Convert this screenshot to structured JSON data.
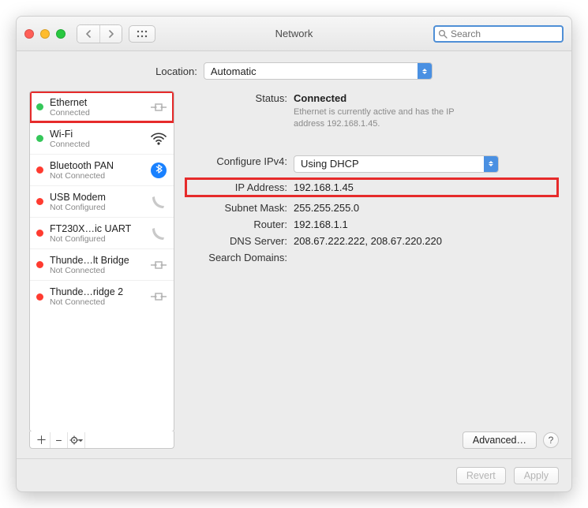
{
  "window": {
    "title": "Network"
  },
  "search": {
    "placeholder": "Search"
  },
  "location": {
    "label": "Location:",
    "value": "Automatic"
  },
  "sidebar": {
    "items": [
      {
        "name": "Ethernet",
        "status": "Connected",
        "dot": "green",
        "icon": "ethernet"
      },
      {
        "name": "Wi-Fi",
        "status": "Connected",
        "dot": "green",
        "icon": "wifi"
      },
      {
        "name": "Bluetooth PAN",
        "status": "Not Connected",
        "dot": "red",
        "icon": "bluetooth"
      },
      {
        "name": "USB Modem",
        "status": "Not Configured",
        "dot": "red",
        "icon": "phone"
      },
      {
        "name": "FT230X…ic UART",
        "status": "Not Configured",
        "dot": "red",
        "icon": "phone"
      },
      {
        "name": "Thunde…lt Bridge",
        "status": "Not Connected",
        "dot": "red",
        "icon": "ethernet"
      },
      {
        "name": "Thunde…ridge 2",
        "status": "Not Connected",
        "dot": "red",
        "icon": "ethernet"
      }
    ]
  },
  "detail": {
    "status_label": "Status:",
    "status_value": "Connected",
    "status_desc": "Ethernet is currently active and has the IP address 192.168.1.45.",
    "configure_label": "Configure IPv4:",
    "configure_value": "Using DHCP",
    "ip_label": "IP Address:",
    "ip_value": "192.168.1.45",
    "subnet_label": "Subnet Mask:",
    "subnet_value": "255.255.255.0",
    "router_label": "Router:",
    "router_value": "192.168.1.1",
    "dns_label": "DNS Server:",
    "dns_value": "208.67.222.222, 208.67.220.220",
    "search_domains_label": "Search Domains:",
    "advanced": "Advanced…",
    "help": "?"
  },
  "footer": {
    "revert": "Revert",
    "apply": "Apply"
  }
}
